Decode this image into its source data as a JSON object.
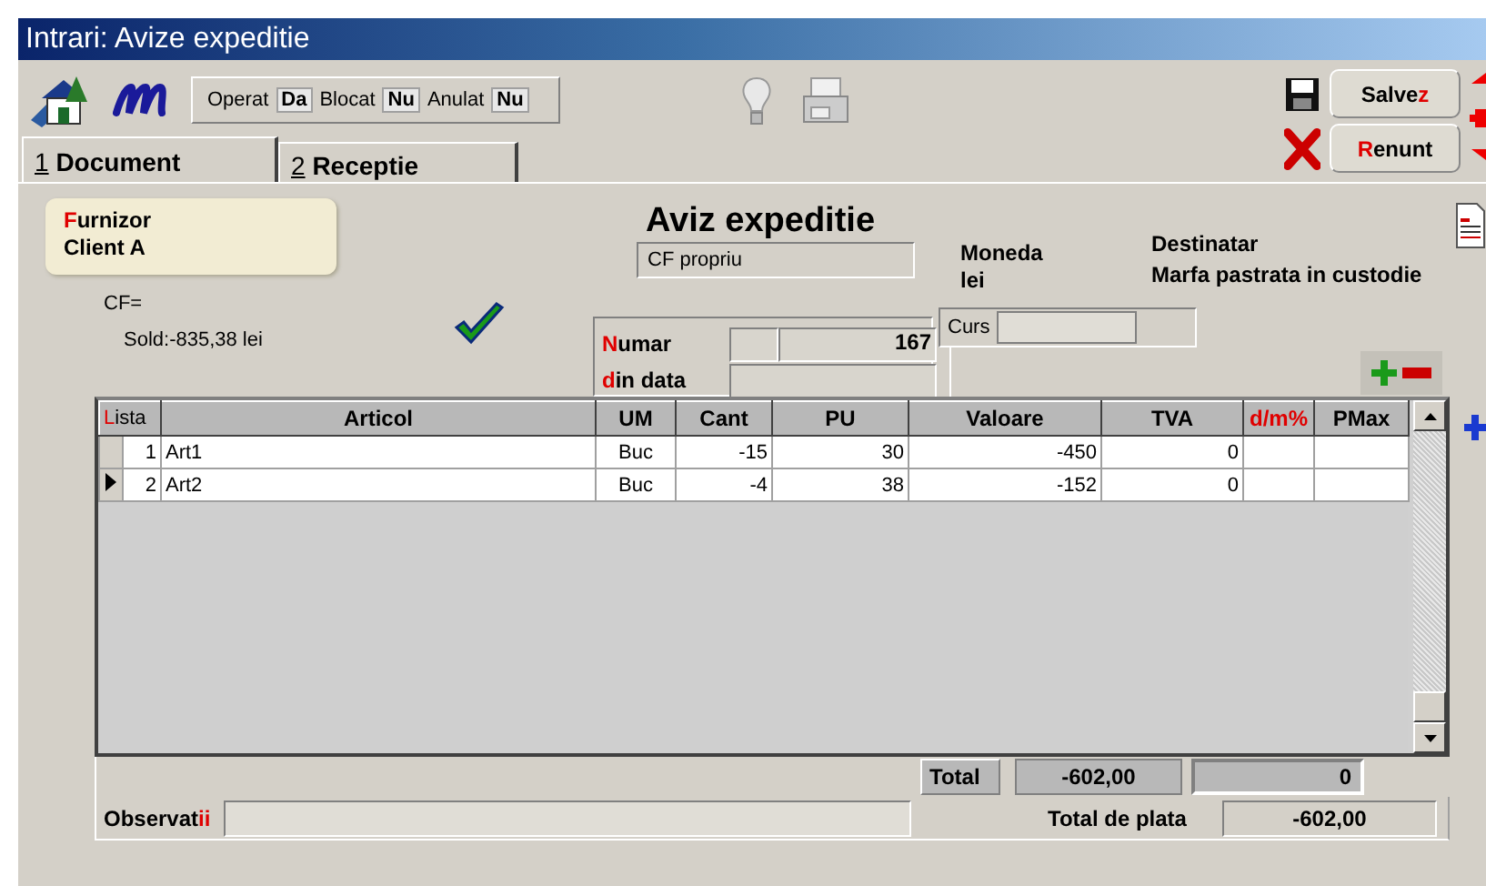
{
  "window": {
    "title": "Intrari: Avize expeditie"
  },
  "toolbar": {
    "flags": [
      {
        "label": "Operat",
        "value": "Da"
      },
      {
        "label": "Blocat",
        "value": "Nu"
      },
      {
        "label": "Anulat",
        "value": "Nu"
      }
    ],
    "buttons": [
      {
        "kind": "save",
        "label": [
          {
            "text": "Salve",
            "hot": false
          },
          {
            "text": "z",
            "hot": true
          }
        ]
      },
      {
        "kind": "cancel",
        "label": [
          {
            "text": "R",
            "hot": true
          },
          {
            "text": "enunt",
            "hot": false
          }
        ]
      }
    ]
  },
  "tabs": [
    {
      "key": "1",
      "label": "Document",
      "selected": true
    },
    {
      "key": "2",
      "label": "Receptie",
      "selected": false
    }
  ],
  "supplier": {
    "label": [
      {
        "text": "F",
        "hot": true
      },
      {
        "text": "urnizor",
        "hot": false
      }
    ],
    "name": "Client A",
    "cf": "CF=",
    "balance": "Sold:-835,38 lei"
  },
  "document": {
    "title": "Aviz expeditie",
    "type": "CF propriu",
    "number_label": [
      {
        "text": "N",
        "hot": true
      },
      {
        "text": "umar",
        "hot": false
      }
    ],
    "number": "167",
    "date_label": [
      {
        "text": "d",
        "hot": true
      },
      {
        "text": "in data",
        "hot": false
      }
    ]
  },
  "currency": {
    "label": "Moneda",
    "value": "lei",
    "rate_label": "Curs"
  },
  "recipient": {
    "label": "Destinatar",
    "value": "Marfa pastrata in custodie"
  },
  "table": {
    "columns": [
      {
        "label": [
          {
            "text": "L",
            "hot": true
          },
          {
            "text": "ista",
            "hot": false
          }
        ]
      },
      {
        "label": [
          {
            "text": "Articol",
            "hot": false
          }
        ]
      },
      {
        "label": [
          {
            "text": "UM",
            "hot": false
          }
        ]
      },
      {
        "label": [
          {
            "text": "Cant",
            "hot": false
          }
        ]
      },
      {
        "label": [
          {
            "text": "PU",
            "hot": false
          }
        ]
      },
      {
        "label": [
          {
            "text": "Valoare",
            "hot": false
          }
        ]
      },
      {
        "label": [
          {
            "text": "TVA",
            "hot": false
          }
        ]
      },
      {
        "label": [
          {
            "text": "d/m%",
            "hot": true
          }
        ]
      },
      {
        "label": [
          {
            "text": "PMax",
            "hot": false
          }
        ]
      }
    ],
    "rows": [
      {
        "selected": false,
        "cells": [
          "1",
          "Art1",
          "Buc",
          "-15",
          "30",
          "-450",
          "0"
        ]
      },
      {
        "selected": true,
        "cells": [
          "2",
          "Art2",
          "Buc",
          "-4",
          "38",
          "-152",
          "0"
        ]
      }
    ]
  },
  "totals": {
    "label": "Total",
    "value": "-602,00",
    "vat": "0"
  },
  "footer": {
    "notes_label": [
      {
        "text": "Observat",
        "hot": false
      },
      {
        "text": "ii",
        "hot": true
      }
    ],
    "payable_label": "Total de plata",
    "payable": "-602,00"
  }
}
